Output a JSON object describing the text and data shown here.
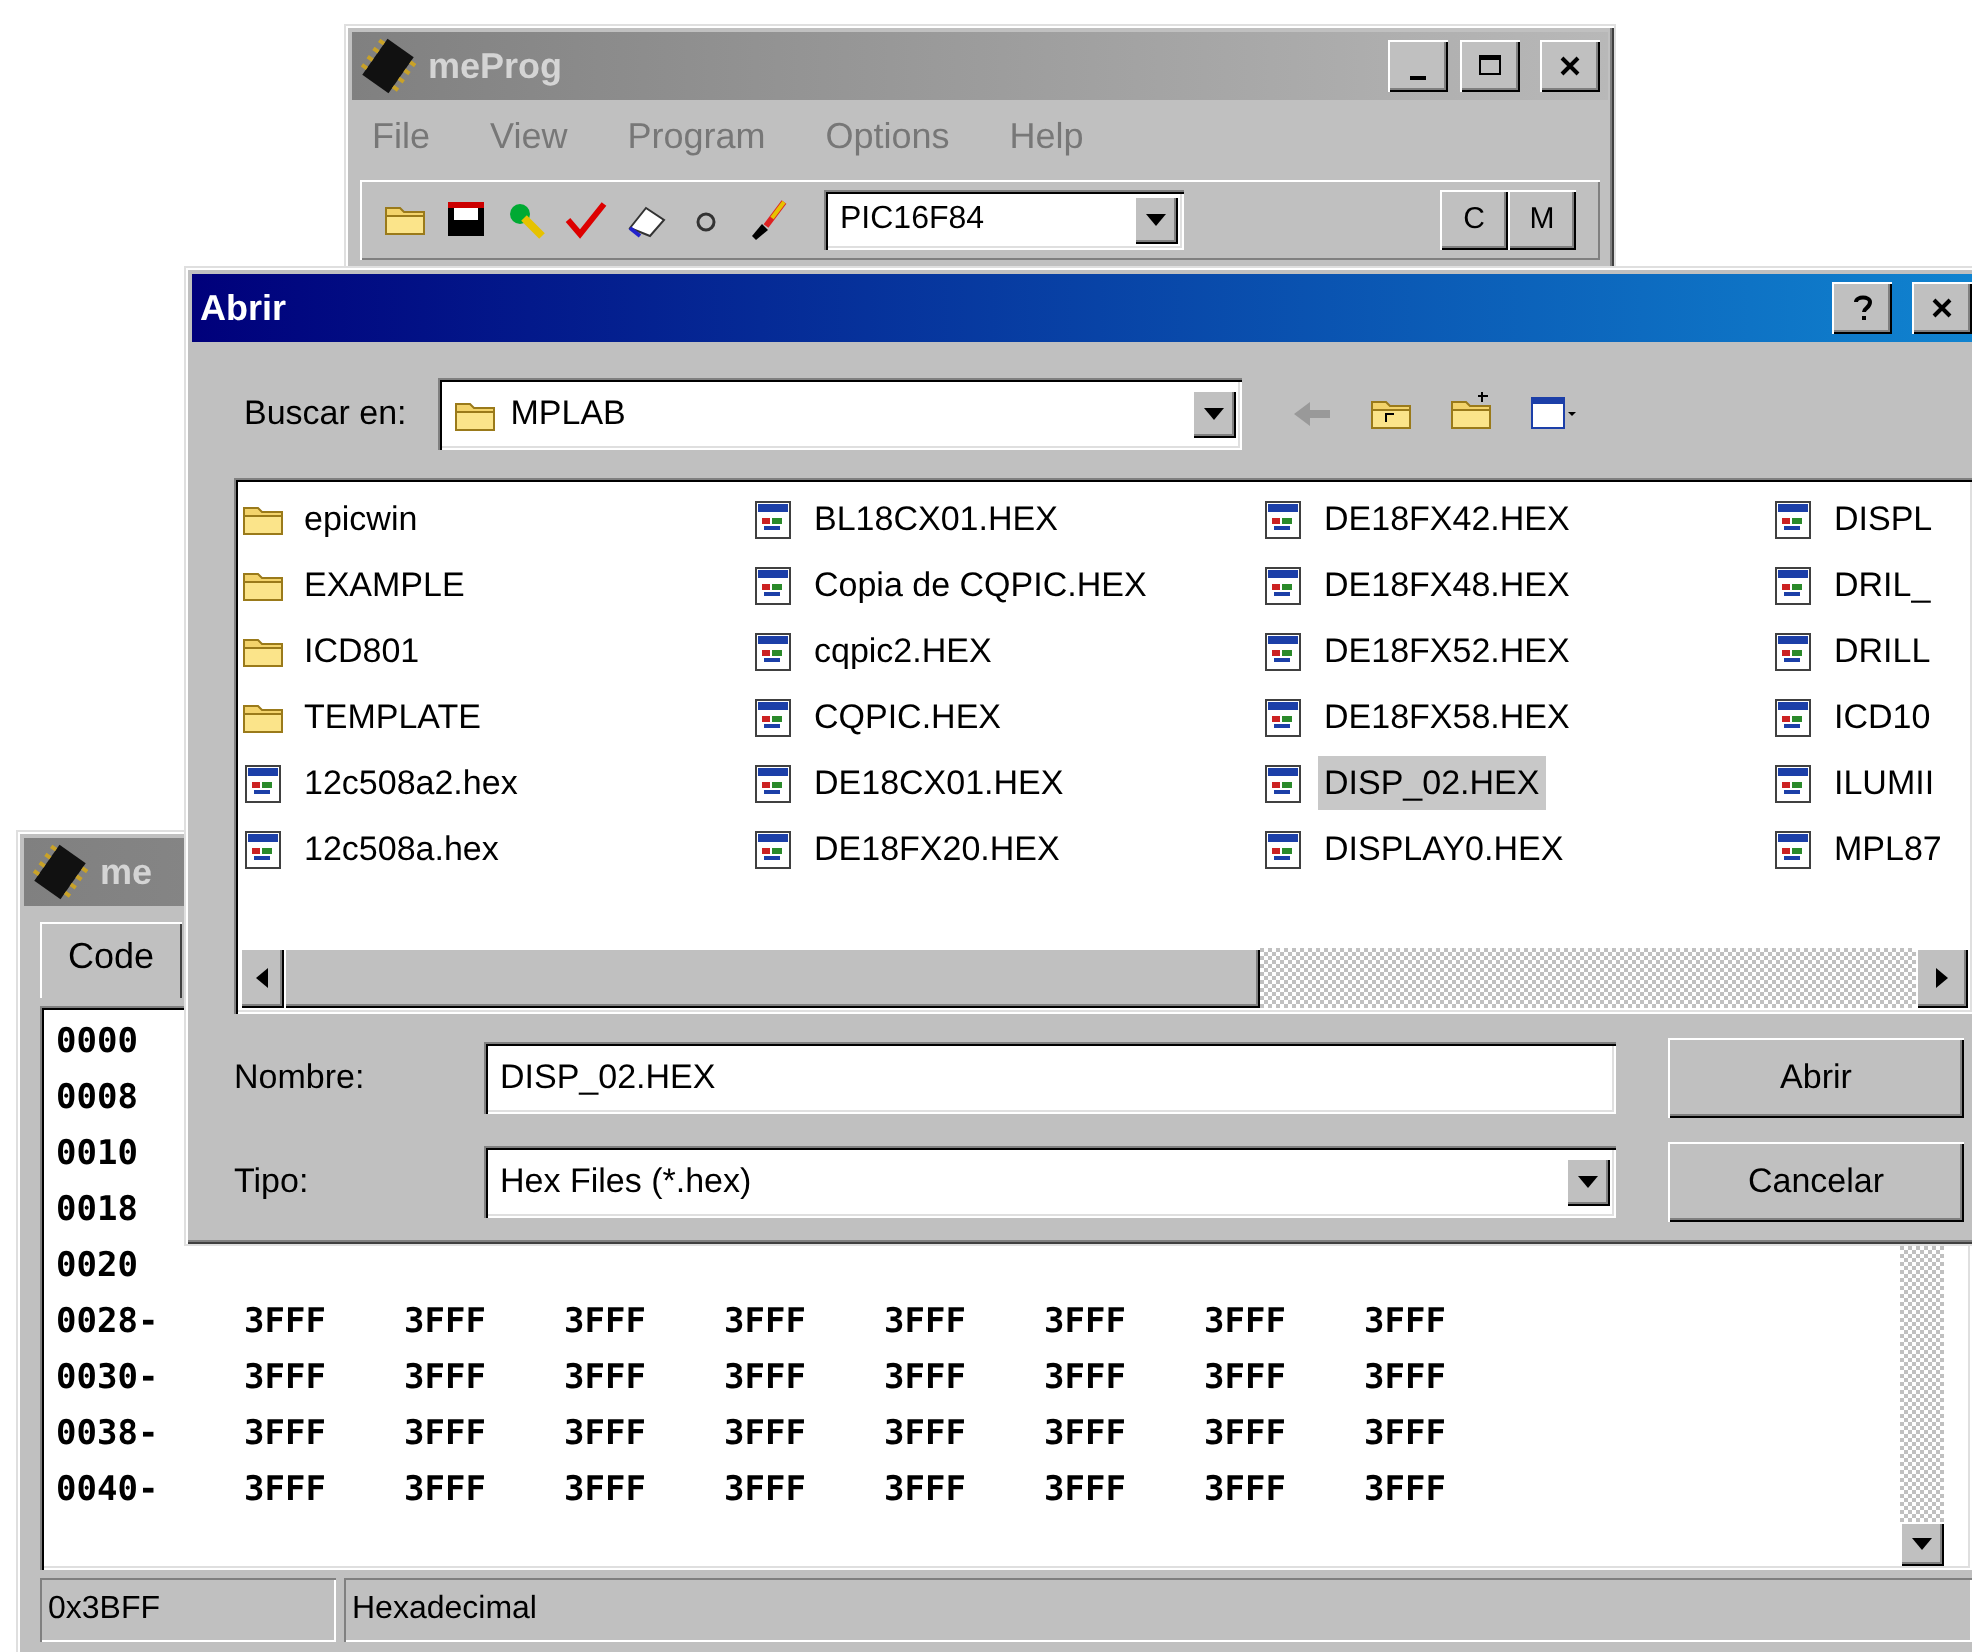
{
  "main_window": {
    "title": "meProg",
    "active": false,
    "menu": [
      "File",
      "View",
      "Program",
      "Options",
      "Help"
    ],
    "toolbar": {
      "device": "PIC16F84",
      "buttons": [
        "C",
        "M"
      ]
    }
  },
  "code_window": {
    "title": "me",
    "active": false,
    "tabs": [
      {
        "label": "Code",
        "selected": true
      }
    ],
    "rows": [
      {
        "address": "0000"
      },
      {
        "address": "0008"
      },
      {
        "address": "0010"
      },
      {
        "address": "0018"
      },
      {
        "address": "0020"
      },
      {
        "address": "0028-",
        "values": [
          "3FFF",
          "3FFF",
          "3FFF",
          "3FFF",
          "3FFF",
          "3FFF",
          "3FFF",
          "3FFF"
        ]
      },
      {
        "address": "0030-",
        "values": [
          "3FFF",
          "3FFF",
          "3FFF",
          "3FFF",
          "3FFF",
          "3FFF",
          "3FFF",
          "3FFF"
        ]
      },
      {
        "address": "0038-",
        "values": [
          "3FFF",
          "3FFF",
          "3FFF",
          "3FFF",
          "3FFF",
          "3FFF",
          "3FFF",
          "3FFF"
        ]
      },
      {
        "address": "0040-",
        "values": [
          "3FFF",
          "3FFF",
          "3FFF",
          "3FFF",
          "3FFF",
          "3FFF",
          "3FFF",
          "3FFF"
        ]
      }
    ],
    "status_bar": [
      "0x3BFF",
      "Hexadecimal"
    ]
  },
  "dialog": {
    "title": "Abrir",
    "active": true,
    "look_in": {
      "label": "Buscar en:",
      "value": "MPLAB"
    },
    "files": [
      [
        {
          "name": "epicwin",
          "kind": "folder",
          "selected": false
        },
        {
          "name": "EXAMPLE",
          "kind": "folder",
          "selected": false
        },
        {
          "name": "ICD801",
          "kind": "folder",
          "selected": false
        },
        {
          "name": "TEMPLATE",
          "kind": "folder",
          "selected": false
        },
        {
          "name": "12c508a2.hex",
          "kind": "file",
          "selected": false
        },
        {
          "name": "12c508a.hex",
          "kind": "file",
          "selected": false
        }
      ],
      [
        {
          "name": "BL18CX01.HEX",
          "kind": "file",
          "selected": false
        },
        {
          "name": "Copia de CQPIC.HEX",
          "kind": "file",
          "selected": false
        },
        {
          "name": "cqpic2.HEX",
          "kind": "file",
          "selected": false
        },
        {
          "name": "CQPIC.HEX",
          "kind": "file",
          "selected": false
        },
        {
          "name": "DE18CX01.HEX",
          "kind": "file",
          "selected": false
        },
        {
          "name": "DE18FX20.HEX",
          "kind": "file",
          "selected": false
        }
      ],
      [
        {
          "name": "DE18FX42.HEX",
          "kind": "file",
          "selected": false
        },
        {
          "name": "DE18FX48.HEX",
          "kind": "file",
          "selected": false
        },
        {
          "name": "DE18FX52.HEX",
          "kind": "file",
          "selected": false
        },
        {
          "name": "DE18FX58.HEX",
          "kind": "file",
          "selected": false
        },
        {
          "name": "DISP_02.HEX",
          "kind": "file",
          "selected": true
        },
        {
          "name": "DISPLAY0.HEX",
          "kind": "file",
          "selected": false
        }
      ],
      [
        {
          "name": "DISPL",
          "kind": "file",
          "selected": false
        },
        {
          "name": "DRIL_",
          "kind": "file",
          "selected": false
        },
        {
          "name": "DRILL",
          "kind": "file",
          "selected": false
        },
        {
          "name": "ICD10",
          "kind": "file",
          "selected": false
        },
        {
          "name": "ILUMII",
          "kind": "file",
          "selected": false
        },
        {
          "name": "MPL87",
          "kind": "file",
          "selected": false
        }
      ]
    ],
    "file_name": {
      "label": "Nombre:",
      "value": "DISP_02.HEX"
    },
    "file_type": {
      "label": "Tipo:",
      "value": "Hex Files (*.hex)"
    },
    "buttons": [
      "Abrir",
      "Cancelar"
    ]
  }
}
